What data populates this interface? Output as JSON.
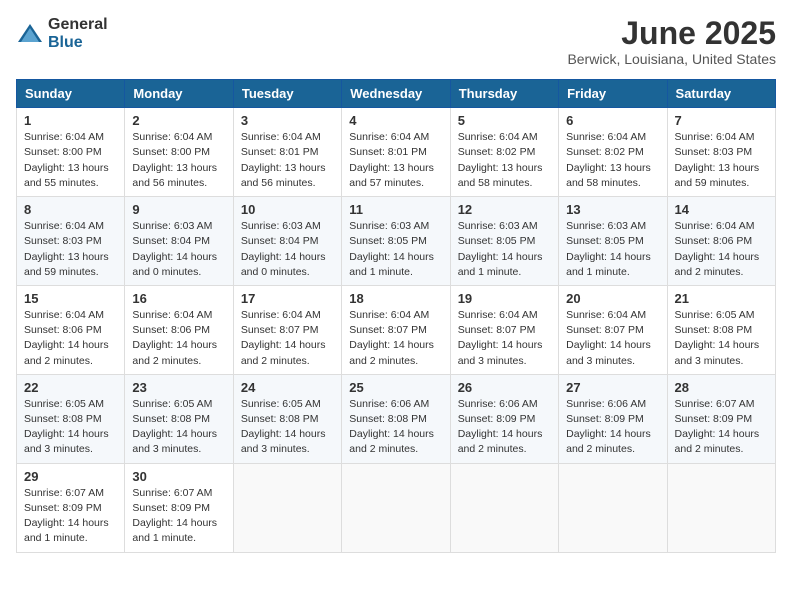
{
  "header": {
    "logo_general": "General",
    "logo_blue": "Blue",
    "month_title": "June 2025",
    "location": "Berwick, Louisiana, United States"
  },
  "days_of_week": [
    "Sunday",
    "Monday",
    "Tuesday",
    "Wednesday",
    "Thursday",
    "Friday",
    "Saturday"
  ],
  "weeks": [
    [
      {
        "day": "1",
        "info": "Sunrise: 6:04 AM\nSunset: 8:00 PM\nDaylight: 13 hours\nand 55 minutes."
      },
      {
        "day": "2",
        "info": "Sunrise: 6:04 AM\nSunset: 8:00 PM\nDaylight: 13 hours\nand 56 minutes."
      },
      {
        "day": "3",
        "info": "Sunrise: 6:04 AM\nSunset: 8:01 PM\nDaylight: 13 hours\nand 56 minutes."
      },
      {
        "day": "4",
        "info": "Sunrise: 6:04 AM\nSunset: 8:01 PM\nDaylight: 13 hours\nand 57 minutes."
      },
      {
        "day": "5",
        "info": "Sunrise: 6:04 AM\nSunset: 8:02 PM\nDaylight: 13 hours\nand 58 minutes."
      },
      {
        "day": "6",
        "info": "Sunrise: 6:04 AM\nSunset: 8:02 PM\nDaylight: 13 hours\nand 58 minutes."
      },
      {
        "day": "7",
        "info": "Sunrise: 6:04 AM\nSunset: 8:03 PM\nDaylight: 13 hours\nand 59 minutes."
      }
    ],
    [
      {
        "day": "8",
        "info": "Sunrise: 6:04 AM\nSunset: 8:03 PM\nDaylight: 13 hours\nand 59 minutes."
      },
      {
        "day": "9",
        "info": "Sunrise: 6:03 AM\nSunset: 8:04 PM\nDaylight: 14 hours\nand 0 minutes."
      },
      {
        "day": "10",
        "info": "Sunrise: 6:03 AM\nSunset: 8:04 PM\nDaylight: 14 hours\nand 0 minutes."
      },
      {
        "day": "11",
        "info": "Sunrise: 6:03 AM\nSunset: 8:05 PM\nDaylight: 14 hours\nand 1 minute."
      },
      {
        "day": "12",
        "info": "Sunrise: 6:03 AM\nSunset: 8:05 PM\nDaylight: 14 hours\nand 1 minute."
      },
      {
        "day": "13",
        "info": "Sunrise: 6:03 AM\nSunset: 8:05 PM\nDaylight: 14 hours\nand 1 minute."
      },
      {
        "day": "14",
        "info": "Sunrise: 6:04 AM\nSunset: 8:06 PM\nDaylight: 14 hours\nand 2 minutes."
      }
    ],
    [
      {
        "day": "15",
        "info": "Sunrise: 6:04 AM\nSunset: 8:06 PM\nDaylight: 14 hours\nand 2 minutes."
      },
      {
        "day": "16",
        "info": "Sunrise: 6:04 AM\nSunset: 8:06 PM\nDaylight: 14 hours\nand 2 minutes."
      },
      {
        "day": "17",
        "info": "Sunrise: 6:04 AM\nSunset: 8:07 PM\nDaylight: 14 hours\nand 2 minutes."
      },
      {
        "day": "18",
        "info": "Sunrise: 6:04 AM\nSunset: 8:07 PM\nDaylight: 14 hours\nand 2 minutes."
      },
      {
        "day": "19",
        "info": "Sunrise: 6:04 AM\nSunset: 8:07 PM\nDaylight: 14 hours\nand 3 minutes."
      },
      {
        "day": "20",
        "info": "Sunrise: 6:04 AM\nSunset: 8:07 PM\nDaylight: 14 hours\nand 3 minutes."
      },
      {
        "day": "21",
        "info": "Sunrise: 6:05 AM\nSunset: 8:08 PM\nDaylight: 14 hours\nand 3 minutes."
      }
    ],
    [
      {
        "day": "22",
        "info": "Sunrise: 6:05 AM\nSunset: 8:08 PM\nDaylight: 14 hours\nand 3 minutes."
      },
      {
        "day": "23",
        "info": "Sunrise: 6:05 AM\nSunset: 8:08 PM\nDaylight: 14 hours\nand 3 minutes."
      },
      {
        "day": "24",
        "info": "Sunrise: 6:05 AM\nSunset: 8:08 PM\nDaylight: 14 hours\nand 3 minutes."
      },
      {
        "day": "25",
        "info": "Sunrise: 6:06 AM\nSunset: 8:08 PM\nDaylight: 14 hours\nand 2 minutes."
      },
      {
        "day": "26",
        "info": "Sunrise: 6:06 AM\nSunset: 8:09 PM\nDaylight: 14 hours\nand 2 minutes."
      },
      {
        "day": "27",
        "info": "Sunrise: 6:06 AM\nSunset: 8:09 PM\nDaylight: 14 hours\nand 2 minutes."
      },
      {
        "day": "28",
        "info": "Sunrise: 6:07 AM\nSunset: 8:09 PM\nDaylight: 14 hours\nand 2 minutes."
      }
    ],
    [
      {
        "day": "29",
        "info": "Sunrise: 6:07 AM\nSunset: 8:09 PM\nDaylight: 14 hours\nand 1 minute."
      },
      {
        "day": "30",
        "info": "Sunrise: 6:07 AM\nSunset: 8:09 PM\nDaylight: 14 hours\nand 1 minute."
      },
      {
        "day": "",
        "info": ""
      },
      {
        "day": "",
        "info": ""
      },
      {
        "day": "",
        "info": ""
      },
      {
        "day": "",
        "info": ""
      },
      {
        "day": "",
        "info": ""
      }
    ]
  ]
}
